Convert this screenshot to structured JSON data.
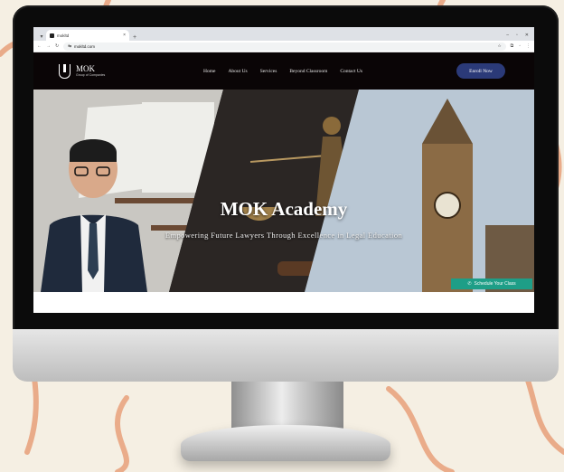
{
  "browser": {
    "tab_title": "mokltd",
    "url": "mokltd.com",
    "new_tab_symbol": "+",
    "close_symbol": "×"
  },
  "site": {
    "logo_name": "MOK",
    "logo_subtitle": "Group of Companies",
    "nav": [
      "Home",
      "About Us",
      "Services",
      "Beyond Classroom",
      "Contact Us"
    ],
    "cta": "Enroll Now"
  },
  "hero": {
    "title": "MOK Academy",
    "subtitle": "Empowering Future Lawyers Through Excellence in Legal Education"
  },
  "schedule_button": "Schedule Your Class",
  "colors": {
    "background": "#f5efe3",
    "swirl": "#e8a07a",
    "header": "#0a0506",
    "cta": "#2b3a78",
    "schedule": "#1e9e87"
  }
}
